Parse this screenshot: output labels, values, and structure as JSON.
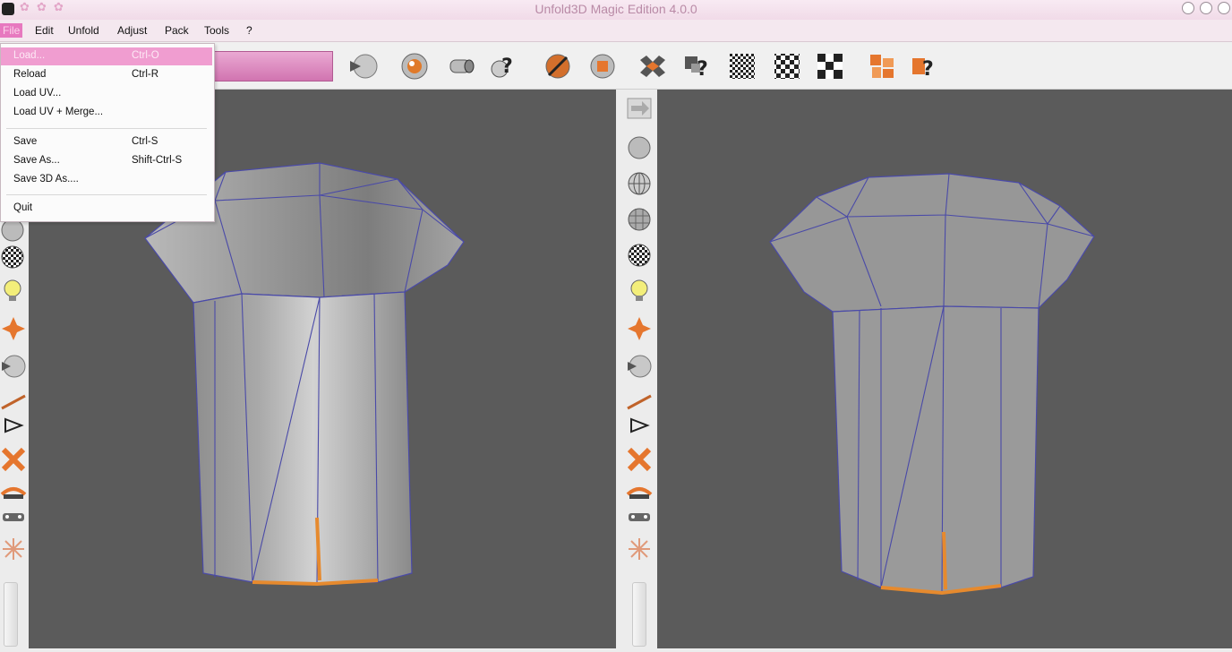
{
  "window": {
    "title": "Unfold3D Magic Edition 4.0.0"
  },
  "menubar": {
    "items": [
      {
        "id": "file",
        "label": "File"
      },
      {
        "id": "edit",
        "label": "Edit"
      },
      {
        "id": "unfold",
        "label": "Unfold"
      },
      {
        "id": "adjust",
        "label": "Adjust"
      },
      {
        "id": "pack",
        "label": "Pack"
      },
      {
        "id": "tools",
        "label": "Tools"
      },
      {
        "id": "help",
        "label": "?"
      }
    ]
  },
  "file_menu": {
    "items": [
      {
        "label": "Load...",
        "shortcut": "Ctrl-O",
        "highlighted": true
      },
      {
        "label": "Reload",
        "shortcut": "Ctrl-R"
      },
      {
        "label": "Load UV...",
        "shortcut": ""
      },
      {
        "label": "Load UV + Merge...",
        "shortcut": ""
      },
      {
        "label": "Save",
        "shortcut": "Ctrl-S"
      },
      {
        "label": "Save As...",
        "shortcut": "Shift-Ctrl-S"
      },
      {
        "label": "Save 3D As....",
        "shortcut": ""
      },
      {
        "label": "Quit",
        "shortcut": ""
      }
    ]
  },
  "toolbar": {
    "icons": [
      "uv-view-icon",
      "render-sphere-icon",
      "cylinder-icon",
      "help-tool-icon",
      "cut-edge-icon",
      "stop-icon",
      "unfold-tool-icon",
      "help-unfold-icon",
      "checker-small-icon",
      "checker-medium-icon",
      "checker-large-icon",
      "pack-icon",
      "help-pack-icon"
    ]
  },
  "viewports": {
    "left": {
      "name": "3D view"
    },
    "right": {
      "name": "UV view"
    }
  },
  "colors": {
    "accent": "#e779bf",
    "viewport_bg": "#5b5b5b",
    "wire": "#4a4aa8",
    "seam": "#e68a2e"
  }
}
